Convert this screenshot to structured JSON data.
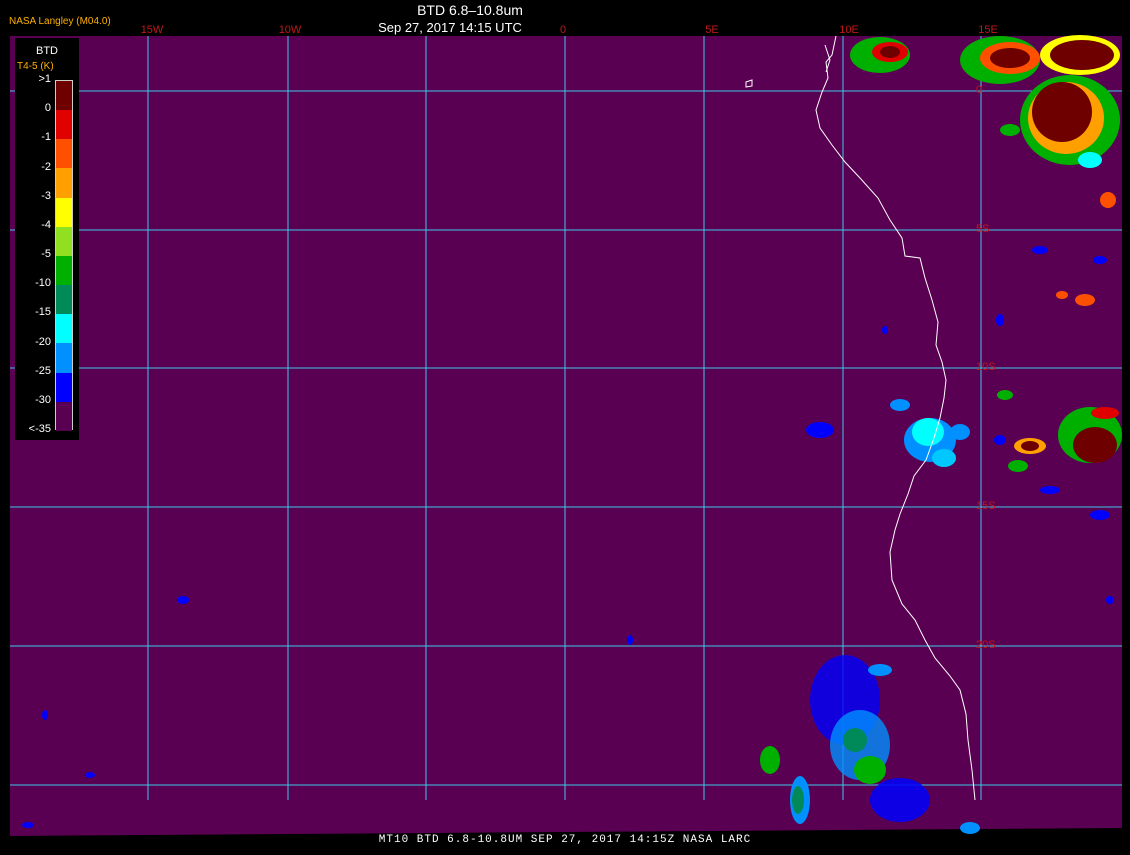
{
  "header": {
    "title": "BTD 6.8–10.8um",
    "subtitle": "Sep 27, 2017 14:15 UTC",
    "provider": "NASA Langley (M04.0)"
  },
  "footer": {
    "caption": "MT10  BTD 6.8-10.8UM   SEP 27, 2017 14:15Z   NASA LARC"
  },
  "legend": {
    "title": "BTD",
    "units": "T4-5 (K)",
    "labels": [
      ">1",
      "0",
      "-1",
      "-2",
      "-3",
      "-4",
      "-5",
      "-10",
      "-15",
      "-20",
      "-25",
      "-30",
      "<-35"
    ],
    "colors": [
      "#6e0000",
      "#e00000",
      "#ff5000",
      "#ffa000",
      "#ffff00",
      "#90e020",
      "#00b000",
      "#008a5a",
      "#00ffff",
      "#0090ff",
      "#0000ff",
      "#5a0052"
    ]
  },
  "map": {
    "background_color": "#5a0052",
    "gridline_color": "#3ec8e8",
    "coastline_color": "#ffffff",
    "longitude_labels": [
      "15W",
      "10W",
      "0",
      "5E",
      "10E",
      "15E"
    ],
    "latitude_labels": [
      "0",
      "5S",
      "10S",
      "15S",
      "20S"
    ]
  }
}
